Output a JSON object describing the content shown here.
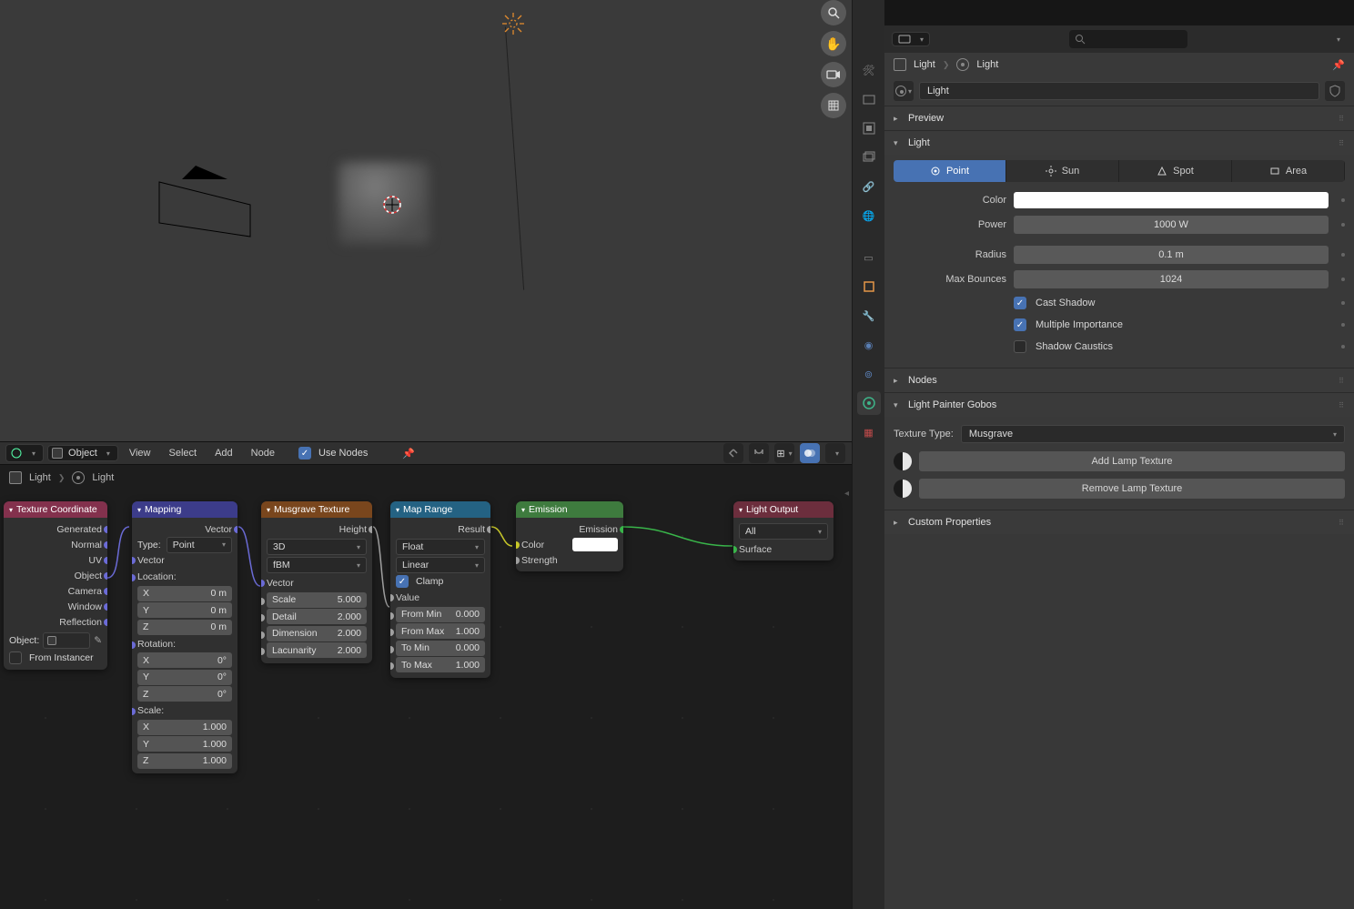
{
  "viewport": {
    "tool_names": [
      "zoom-icon",
      "pan-icon",
      "camera-icon",
      "grid-icon"
    ]
  },
  "node_header": {
    "mode": "Object",
    "menus": [
      "View",
      "Select",
      "Add",
      "Node"
    ],
    "use_nodes_label": "Use Nodes"
  },
  "breadcrumb": {
    "obj": "Light",
    "data": "Light"
  },
  "nodes": {
    "tex_coord": {
      "title": "Texture Coordinate",
      "outs": [
        "Generated",
        "Normal",
        "UV",
        "Object",
        "Camera",
        "Window",
        "Reflection"
      ],
      "object_label": "Object:",
      "from_instancer": "From Instancer"
    },
    "mapping": {
      "title": "Mapping",
      "out": "Vector",
      "type_label": "Type:",
      "type_value": "Point",
      "in_vector": "Vector",
      "loc_label": "Location:",
      "rot_label": "Rotation:",
      "scale_label": "Scale:",
      "loc": [
        [
          "X",
          "0 m"
        ],
        [
          "Y",
          "0 m"
        ],
        [
          "Z",
          "0 m"
        ]
      ],
      "rot": [
        [
          "X",
          "0°"
        ],
        [
          "Y",
          "0°"
        ],
        [
          "Z",
          "0°"
        ]
      ],
      "scale": [
        [
          "X",
          "1.000"
        ],
        [
          "Y",
          "1.000"
        ],
        [
          "Z",
          "1.000"
        ]
      ]
    },
    "musgrave": {
      "title": "Musgrave Texture",
      "out": "Height",
      "dim": "3D",
      "model": "fBM",
      "in_vector": "Vector",
      "params": [
        [
          "Scale",
          "5.000"
        ],
        [
          "Detail",
          "2.000"
        ],
        [
          "Dimension",
          "2.000"
        ],
        [
          "Lacunarity",
          "2.000"
        ]
      ]
    },
    "maprange": {
      "title": "Map Range",
      "out": "Result",
      "dtype": "Float",
      "interp": "Linear",
      "clamp": "Clamp",
      "in_value": "Value",
      "params": [
        [
          "From Min",
          "0.000"
        ],
        [
          "From Max",
          "1.000"
        ],
        [
          "To Min",
          "0.000"
        ],
        [
          "To Max",
          "1.000"
        ]
      ]
    },
    "emission": {
      "title": "Emission",
      "out": "Emission",
      "color": "Color",
      "strength": "Strength"
    },
    "output": {
      "title": "Light Output",
      "target": "All",
      "surface": "Surface"
    }
  },
  "props": {
    "search_placeholder": "",
    "bc_obj": "Light",
    "bc_data": "Light",
    "data_id": "Light",
    "sections": {
      "preview": "Preview",
      "light": "Light",
      "nodes": "Nodes",
      "gobos": "Light Painter Gobos",
      "custom": "Custom Properties"
    },
    "light_types": [
      "Point",
      "Sun",
      "Spot",
      "Area"
    ],
    "light": {
      "color": "Color",
      "power": "Power",
      "power_v": "1000 W",
      "radius": "Radius",
      "radius_v": "0.1 m",
      "bounces": "Max Bounces",
      "bounces_v": "1024",
      "cast": "Cast Shadow",
      "multi": "Multiple Importance",
      "caustics": "Shadow Caustics"
    },
    "gobos": {
      "tt_label": "Texture Type:",
      "tt_value": "Musgrave",
      "add": "Add Lamp Texture",
      "remove": "Remove Lamp Texture"
    }
  }
}
